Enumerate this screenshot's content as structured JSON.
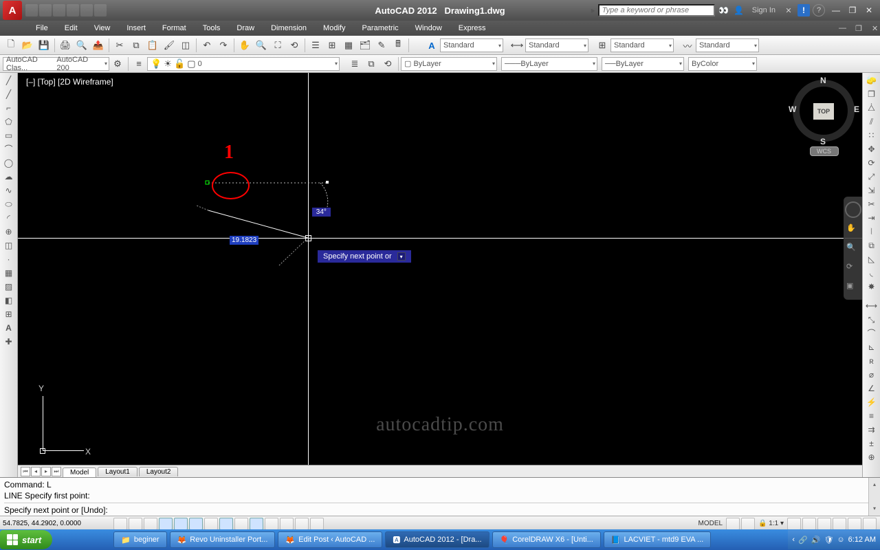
{
  "title": {
    "app": "AutoCAD 2012",
    "doc": "Drawing1.dwg"
  },
  "search_placeholder": "Type a keyword or phrase",
  "sign_in": "Sign In",
  "menu": [
    "File",
    "Edit",
    "View",
    "Insert",
    "Format",
    "Tools",
    "Draw",
    "Dimension",
    "Modify",
    "Parametric",
    "Window",
    "Express"
  ],
  "workspace": {
    "left": "AutoCAD Clas...",
    "right": "AutoCAD 200"
  },
  "layer": {
    "current": "0"
  },
  "styles": {
    "std": "Standard"
  },
  "props": {
    "layer": "ByLayer",
    "lw": "ByLayer",
    "lt": "ByLayer",
    "color": "ByColor"
  },
  "viewport_label": "[–] [Top] [2D Wireframe]",
  "dynamic": {
    "dist": "19.1823",
    "angle": "34°",
    "tooltip": "Specify next point or"
  },
  "annotation": {
    "num": "1"
  },
  "viewcube": {
    "face": "TOP",
    "n": "N",
    "s": "S",
    "e": "E",
    "w": "W",
    "wcs": "WCS"
  },
  "watermark": "autocadtip.com",
  "tabs": {
    "model": "Model",
    "l1": "Layout1",
    "l2": "Layout2"
  },
  "command": {
    "l1": "Command: L",
    "l2": "LINE Specify first point:",
    "l3": "Specify next point or [Undo]:"
  },
  "status": {
    "coords": "54.7825, 44.2902, 0.0000",
    "model": "MODEL",
    "scale": "1:1"
  },
  "taskbar": {
    "start": "start",
    "items": [
      {
        "label": "beginer"
      },
      {
        "label": "Revo Uninstaller Port..."
      },
      {
        "label": "Edit Post ‹ AutoCAD ..."
      },
      {
        "label": "AutoCAD 2012 - [Dra...",
        "active": true
      },
      {
        "label": "CorelDRAW X6 - [Unti..."
      },
      {
        "label": "LACVIET - mtd9 EVA ..."
      }
    ],
    "clock": "6:12 AM"
  }
}
